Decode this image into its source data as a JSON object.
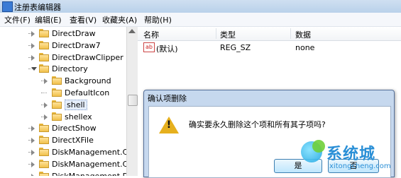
{
  "window": {
    "title": "注册表编辑器"
  },
  "menu": [
    "文件(F)",
    "编辑(E)",
    "查看(V)",
    "收藏夹(A)",
    "帮助(H)"
  ],
  "tree": [
    {
      "label": "DirectDraw",
      "level": 0,
      "expanded": false
    },
    {
      "label": "DirectDraw7",
      "level": 0,
      "expanded": false
    },
    {
      "label": "DirectDrawClipper",
      "level": 0,
      "expanded": false
    },
    {
      "label": "Directory",
      "level": 0,
      "expanded": true
    },
    {
      "label": "Background",
      "level": 1,
      "expanded": false
    },
    {
      "label": "DefaultIcon",
      "level": 1,
      "expanded": null
    },
    {
      "label": "shell",
      "level": 1,
      "expanded": false,
      "selected": true
    },
    {
      "label": "shellex",
      "level": 1,
      "expanded": false
    },
    {
      "label": "DirectShow",
      "level": 0,
      "expanded": false
    },
    {
      "label": "DirectXFile",
      "level": 0,
      "expanded": false
    },
    {
      "label": "DiskManagement.Cor",
      "level": 0,
      "expanded": false
    },
    {
      "label": "DiskManagement.Cor",
      "level": 0,
      "expanded": false
    },
    {
      "label": "DiskManagement.Dat",
      "level": 0,
      "expanded": false
    }
  ],
  "list": {
    "headers": {
      "name": "名称",
      "type": "类型",
      "data": "数据"
    },
    "rows": [
      {
        "name": "(默认)",
        "type": "REG_SZ",
        "data": "none",
        "icon": "ab"
      }
    ]
  },
  "dialog": {
    "title": "确认项删除",
    "message": "确实要永久删除这个项和所有其子项吗?",
    "yes": "是",
    "no": "否"
  },
  "watermark": {
    "brand": "系统城",
    "url": "xitongcheng.com"
  }
}
